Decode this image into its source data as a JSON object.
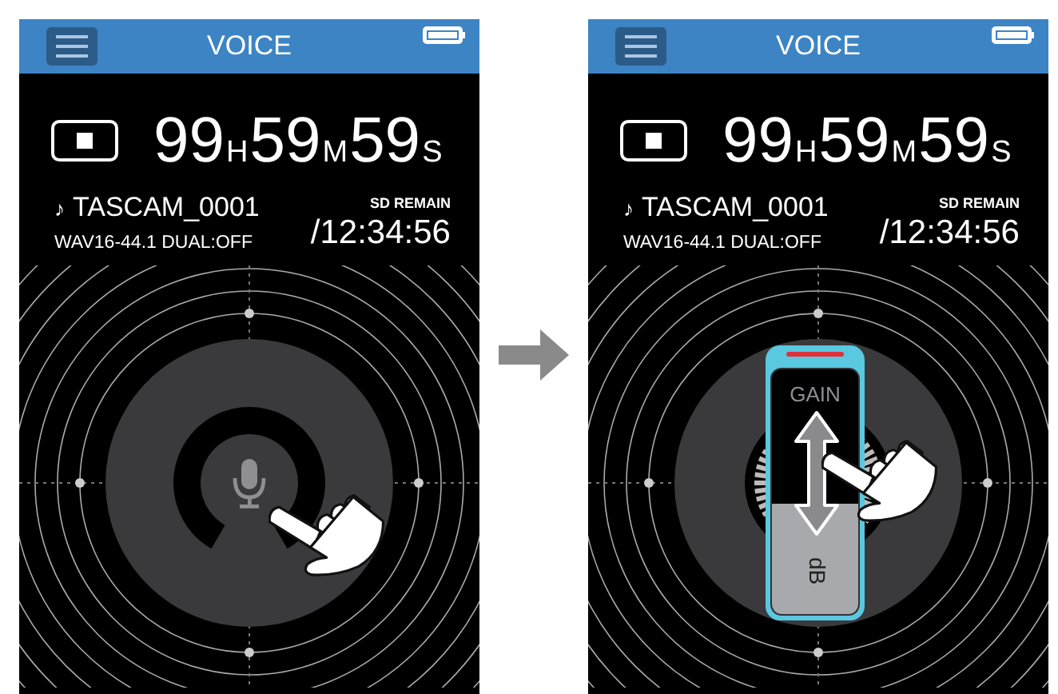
{
  "screens": [
    {
      "header": {
        "title": "VOICE"
      },
      "timer": {
        "hours": "99",
        "h_unit": "H",
        "minutes": "59",
        "m_unit": "M",
        "seconds": "59",
        "s_unit": "S"
      },
      "file": {
        "note": "♪",
        "name": "TASCAM_0001",
        "format": "WAV16-44.1 DUAL:OFF"
      },
      "remain": {
        "label": "SD REMAIN",
        "time": "/12:34:56"
      },
      "control": {
        "kind": "mic"
      }
    },
    {
      "header": {
        "title": "VOICE"
      },
      "timer": {
        "hours": "99",
        "h_unit": "H",
        "minutes": "59",
        "m_unit": "M",
        "seconds": "59",
        "s_unit": "S"
      },
      "file": {
        "note": "♪",
        "name": "TASCAM_0001",
        "format": "WAV16-44.1 DUAL:OFF"
      },
      "remain": {
        "label": "SD REMAIN",
        "time": "/12:34:56"
      },
      "control": {
        "kind": "gain",
        "label": "GAIN",
        "unit": "dB",
        "level": 0.45
      }
    }
  ]
}
